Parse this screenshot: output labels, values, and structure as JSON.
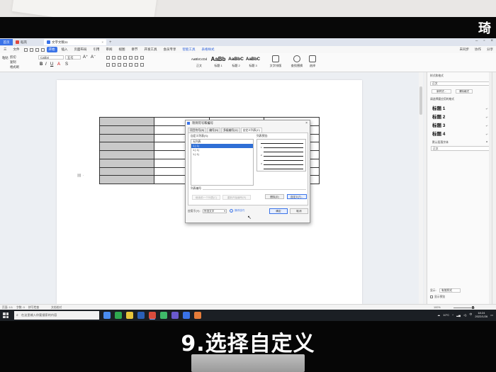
{
  "caption": "9.选择自定义",
  "watermark": "琦",
  "tabs": [
    {
      "label": "首页",
      "kind": "home"
    },
    {
      "label": "稻壳",
      "kind": "normal",
      "color": "#e0483e"
    },
    {
      "label": "文字文稿11",
      "kind": "active",
      "color": "#3a73e8"
    }
  ],
  "menu": {
    "quick_items": [
      "三",
      "文件"
    ],
    "items": [
      "开始",
      "插入",
      "页面布局",
      "引用",
      "审阅",
      "视图",
      "章节",
      "开发工具",
      "会员专享",
      "智能工具",
      "表格样式"
    ],
    "selected_index": 0,
    "right": [
      "未同步",
      "协作",
      "分享"
    ]
  },
  "ribbon": {
    "clipboard": [
      "粘贴",
      "剪切",
      "复制",
      "格式刷"
    ],
    "font_name": "Calibri",
    "font_size": "五号",
    "styles": [
      {
        "sample": "AaBbCcDd",
        "caption": "正文"
      },
      {
        "sample": "AaBb",
        "caption": "标题 1"
      },
      {
        "sample": "AaBbC",
        "caption": "标题 2"
      },
      {
        "sample": "AaBbC",
        "caption": "标题 3"
      }
    ],
    "right_buttons": [
      "文字排版",
      "查找替换",
      "选择"
    ]
  },
  "dialog": {
    "title": "项目符号和编号",
    "close": "×",
    "tabs": [
      "项目符号(B)",
      "编号(N)",
      "多级编号(U)",
      "自定义列表(C)"
    ],
    "active_tab_index": 3,
    "list_label": "自定义列表(S):",
    "list_items": [
      "无列表",
      "1.) 1)",
      "1.) 1)",
      "1.) 1)"
    ],
    "selected_index": 1,
    "preview_label": "列表预览:",
    "preview_numbers": [
      "1",
      "2",
      "3"
    ],
    "group_label": "列表编号",
    "buttons_left": [
      "继续前一个列表(C)",
      "重新开始编号(R)"
    ],
    "delete_button": "删除(D)",
    "custom_button": "自定义(T)...",
    "apply_label": "应用于(Y):",
    "apply_value": "所选文字",
    "tip_link": "操作技巧",
    "ok": "确定",
    "cancel": "取消"
  },
  "right_panel": {
    "title": "样式和格式",
    "current_style": "正文",
    "new_style": "新样式...",
    "clear": "清除格式",
    "pick_label": "请选择要应用的格式",
    "styles": [
      "标题 1",
      "标题 2",
      "标题 3",
      "标题 4"
    ],
    "default_font": "默认段落字体",
    "body": "正文",
    "show_label": "显示:",
    "show_value": "有效样式",
    "preview_check": "显示预览"
  },
  "status": {
    "page": "页面: 1/1",
    "words": "字数: 0",
    "spell": "拼写检查",
    "doc_check": "文档校对",
    "zoom": "100%"
  },
  "taskbar": {
    "search_placeholder": "在这里输入你要搜索的内容",
    "temperature": "10°C",
    "ime": "中",
    "time": "18:24",
    "date": "2022/1/26",
    "app_colors": [
      "#4a8cf0",
      "#2fa84f",
      "#e8c53a",
      "#2a5fb8",
      "#d94c3d",
      "#3fb96a",
      "#6a5acd",
      "#3a73e8",
      "#e57c3a"
    ]
  }
}
